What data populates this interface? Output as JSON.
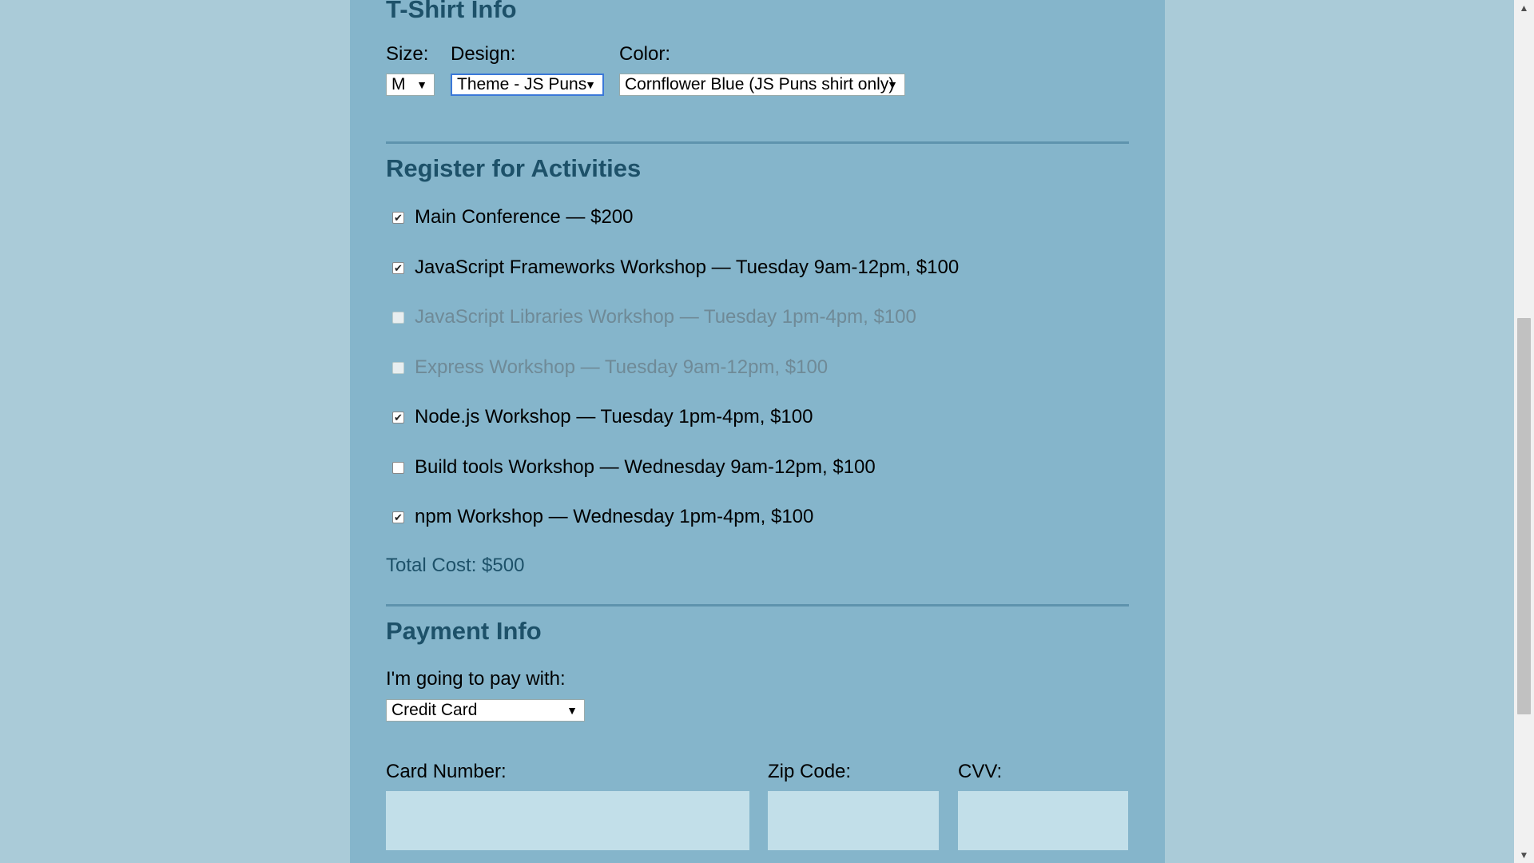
{
  "tshirt": {
    "heading": "T-Shirt Info",
    "size_label": "Size:",
    "size_value": "M",
    "design_label": "Design:",
    "design_value": "Theme - JS Puns",
    "color_label": "Color:",
    "color_value": "Cornflower Blue (JS Puns shirt only)"
  },
  "activities": {
    "heading": "Register for Activities",
    "items": [
      {
        "label": "Main Conference — $200",
        "checked": true,
        "disabled": false
      },
      {
        "label": "JavaScript Frameworks Workshop — Tuesday 9am-12pm, $100",
        "checked": true,
        "disabled": false
      },
      {
        "label": "JavaScript Libraries Workshop — Tuesday 1pm-4pm, $100",
        "checked": false,
        "disabled": true
      },
      {
        "label": "Express Workshop — Tuesday 9am-12pm, $100",
        "checked": false,
        "disabled": true
      },
      {
        "label": "Node.js Workshop — Tuesday 1pm-4pm, $100",
        "checked": true,
        "disabled": false
      },
      {
        "label": "Build tools Workshop — Wednesday 9am-12pm, $100",
        "checked": false,
        "disabled": false
      },
      {
        "label": "npm Workshop — Wednesday 1pm-4pm, $100",
        "checked": true,
        "disabled": false
      }
    ],
    "total": "Total Cost: $500"
  },
  "payment": {
    "heading": "Payment Info",
    "method_label": "I'm going to pay with:",
    "method_value": "Credit Card",
    "card_label": "Card Number:",
    "zip_label": "Zip Code:",
    "cvv_label": "CVV:"
  },
  "icons": {
    "dropdown_arrow": "▼",
    "check_mark": "✔",
    "scroll_up": "▲",
    "scroll_down": "▼"
  },
  "colors": {
    "page_bg": "#aacbd8",
    "panel_bg": "#85b5cb",
    "heading": "#1d5169",
    "field_bg": "#c2dfe9"
  }
}
